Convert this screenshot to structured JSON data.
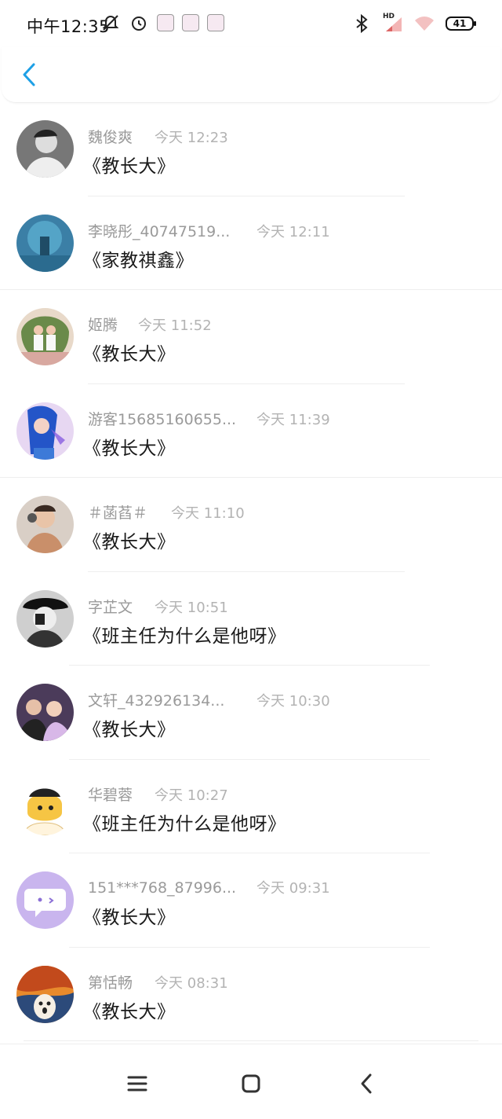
{
  "status_bar": {
    "time": "中午12:35",
    "battery": "41",
    "network": "HD"
  },
  "header": {
    "back_icon": "chevron-left-icon"
  },
  "items": [
    {
      "name": "魏俊爽",
      "time": "今天 12:23",
      "content": "《教长大》",
      "avatar": "portrait-bw"
    },
    {
      "name": "李晓彤_40747519...",
      "time": "今天 12:11",
      "content": "《家教祺鑫》",
      "avatar": "blue-scene"
    },
    {
      "name": "姬腾",
      "time": "今天 11:52",
      "content": "《教长大》",
      "avatar": "couple-photo"
    },
    {
      "name": "游客15685160655...",
      "time": "今天 11:39",
      "content": "《教长大》",
      "avatar": "anime-blue-hair"
    },
    {
      "name": "＃菡萏＃",
      "time": "今天 11:10",
      "content": "《教长大》",
      "avatar": "girl-photo"
    },
    {
      "name": "字芷文",
      "time": "今天 10:51",
      "content": "《班主任为什么是他呀》",
      "avatar": "man-hat-bw"
    },
    {
      "name": "文轩_432926134...",
      "time": "今天 10:30",
      "content": "《教长大》",
      "avatar": "stage-photo"
    },
    {
      "name": "华碧蓉",
      "time": "今天 10:27",
      "content": "《班主任为什么是他呀》",
      "avatar": "cartoon-yellow"
    },
    {
      "name": "151***768_87996...",
      "time": "今天 09:31",
      "content": "《教长大》",
      "avatar": "default-chat-bubble"
    },
    {
      "name": "第恬畅",
      "time": "今天 08:31",
      "content": "《教长大》",
      "avatar": "scream-painting"
    }
  ],
  "nav": {
    "menu": "menu-icon",
    "home": "home-icon",
    "back": "back-icon"
  }
}
